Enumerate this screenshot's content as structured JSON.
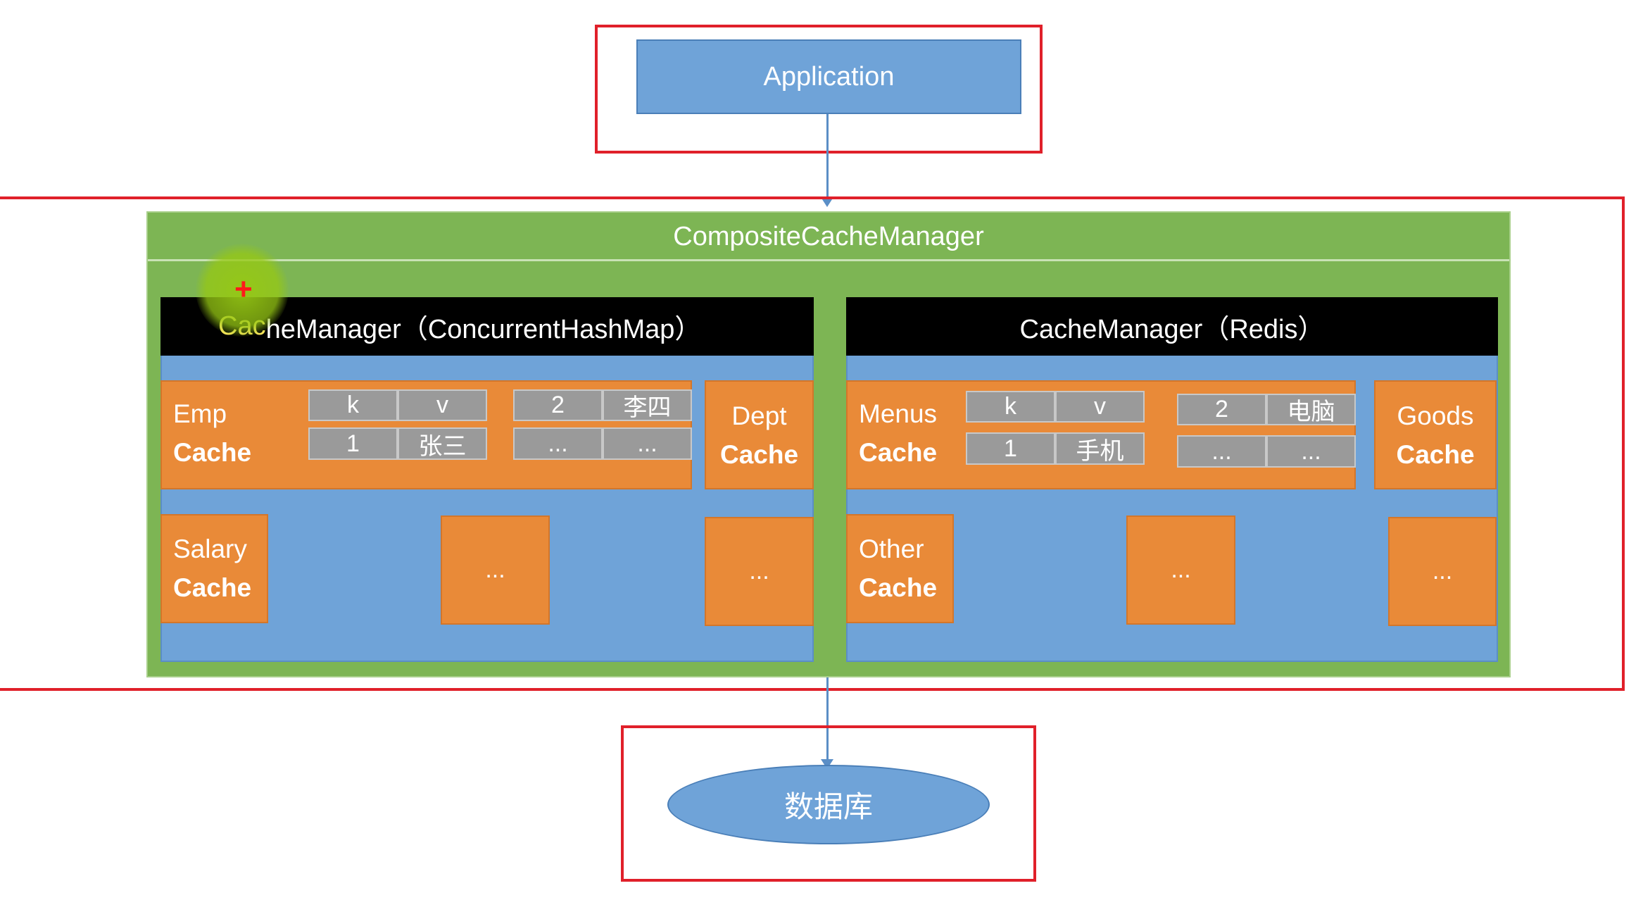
{
  "application": {
    "label": "Application"
  },
  "composite": {
    "title": "CompositeCacheManager"
  },
  "left_manager": {
    "title_prefix": "Cac",
    "title_rest": "heManager（ConcurrentHashMap）",
    "emp": {
      "line1": "Emp",
      "line2": "Cache"
    },
    "table": {
      "h1": "k",
      "h2": "v",
      "r1c1": "1",
      "r1c2": "张三",
      "h3": "2",
      "h4": "李四",
      "r2c3": "...",
      "r2c4": "..."
    },
    "dept": {
      "line1": "Dept",
      "line2": "Cache"
    },
    "salary": {
      "line1": "Salary",
      "line2": "Cache"
    },
    "more1": "...",
    "more2": "..."
  },
  "right_manager": {
    "title": "CacheManager（Redis）",
    "menus": {
      "line1": "Menus",
      "line2": "Cache"
    },
    "table": {
      "h1": "k",
      "h2": "v",
      "r1c1": "1",
      "r1c2": "手机",
      "h3": "2",
      "h4": "电脑",
      "r2c3": "...",
      "r2c4": "..."
    },
    "goods": {
      "line1": "Goods",
      "line2": "Cache"
    },
    "other": {
      "line1": "Other",
      "line2": "Cache"
    },
    "more1": "...",
    "more2": "..."
  },
  "database": {
    "label": "数据库"
  },
  "colors": {
    "frame": "#e0202a",
    "box_blue": "#6fa3d8",
    "composite_green": "#7db554",
    "manager_black": "#000000",
    "cache_orange": "#e98a38",
    "cell_gray": "#9a9a9a"
  },
  "icons": [
    "cursor-crosshair-icon"
  ]
}
